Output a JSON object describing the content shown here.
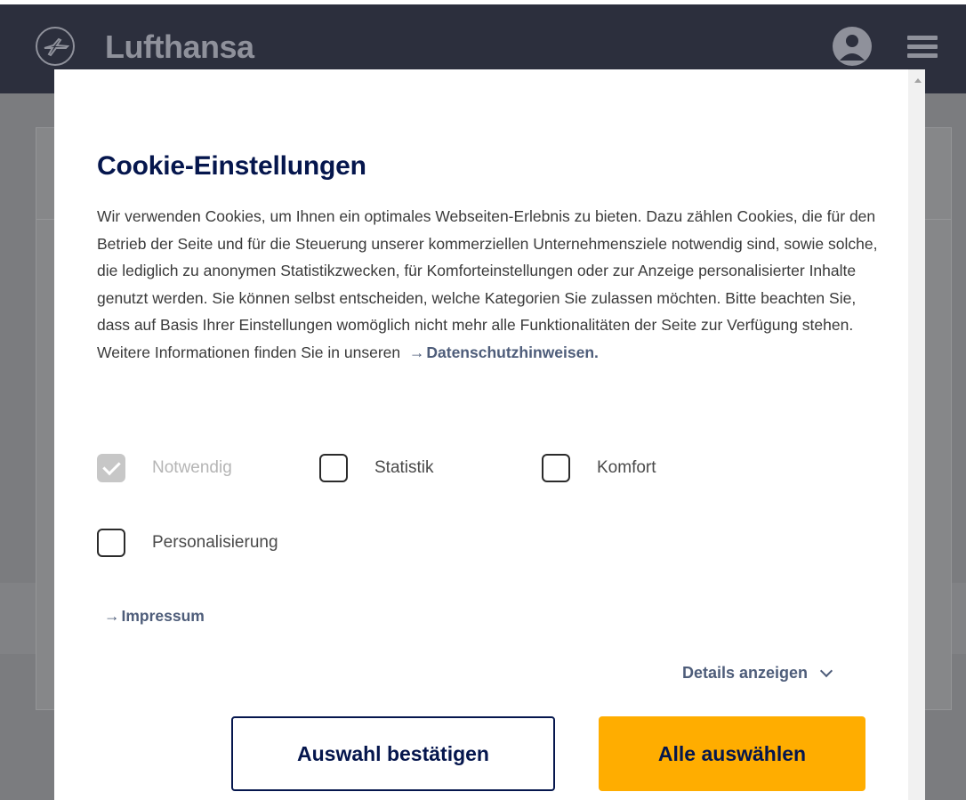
{
  "header": {
    "brand": "Lufthansa"
  },
  "modal": {
    "title": "Cookie-Einstellungen",
    "body": "Wir verwenden Cookies, um Ihnen ein optimales Webseiten-Erlebnis zu bieten. Dazu zählen Cookies, die für den Betrieb der Seite und für die Steuerung unserer kommerziellen Unternehmensziele notwendig sind, sowie solche, die lediglich zu anonymen Statistikzwecken, für Komforteinstellungen oder zur Anzeige personalisierter Inhalte genutzt werden. Sie können selbst entscheiden, welche Kategorien Sie zulassen möchten. Bitte beachten Sie, dass auf Basis Ihrer Einstellungen womöglich nicht mehr alle Funktionalitäten der Seite zur Verfügung stehen. Weitere Informationen finden Sie in unseren",
    "privacy_arrow": "→",
    "privacy_link": "Datenschutzhinweisen.",
    "options": [
      {
        "label": "Notwendig",
        "checked": true,
        "disabled": true
      },
      {
        "label": "Statistik",
        "checked": false,
        "disabled": false
      },
      {
        "label": "Komfort",
        "checked": false,
        "disabled": false
      },
      {
        "label": "Personalisierung",
        "checked": false,
        "disabled": false
      }
    ],
    "impressum_arrow": "→",
    "impressum": "Impressum",
    "details": "Details anzeigen",
    "confirm_button": "Auswahl bestätigen",
    "accept_all_button": "Alle auswählen"
  },
  "colors": {
    "navy": "#05164d",
    "accent_yellow": "#ffad00",
    "link": "#4e5d7a"
  }
}
